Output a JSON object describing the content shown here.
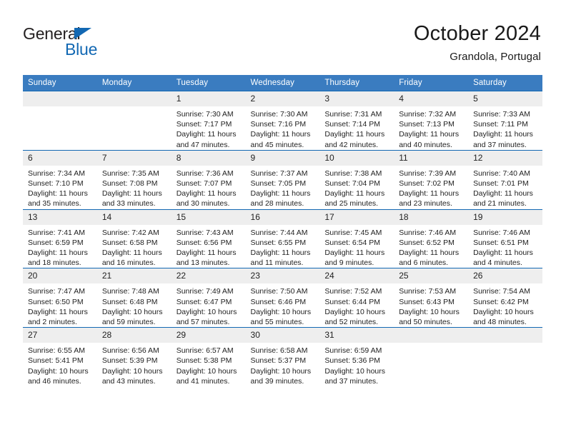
{
  "logo": {
    "word_general": "General",
    "word_blue": "Blue",
    "triangle_color": "#1268b3"
  },
  "header": {
    "title": "October 2024",
    "subtitle": "Grandola, Portugal",
    "accent_color": "#3a7cc0",
    "row_border_color": "#1268b3",
    "daynum_band_color": "#eeeeee"
  },
  "weekday_headers": [
    "Sunday",
    "Monday",
    "Tuesday",
    "Wednesday",
    "Thursday",
    "Friday",
    "Saturday"
  ],
  "labels": {
    "sunrise_prefix": "Sunrise:",
    "sunset_prefix": "Sunset:",
    "daylight_prefix": "Daylight:"
  },
  "weeks": [
    [
      {
        "day": "",
        "empty": true
      },
      {
        "day": "",
        "empty": true
      },
      {
        "day": "1",
        "sunrise": "Sunrise: 7:30 AM",
        "sunset": "Sunset: 7:17 PM",
        "daylight_l1": "Daylight: 11 hours",
        "daylight_l2": "and 47 minutes."
      },
      {
        "day": "2",
        "sunrise": "Sunrise: 7:30 AM",
        "sunset": "Sunset: 7:16 PM",
        "daylight_l1": "Daylight: 11 hours",
        "daylight_l2": "and 45 minutes."
      },
      {
        "day": "3",
        "sunrise": "Sunrise: 7:31 AM",
        "sunset": "Sunset: 7:14 PM",
        "daylight_l1": "Daylight: 11 hours",
        "daylight_l2": "and 42 minutes."
      },
      {
        "day": "4",
        "sunrise": "Sunrise: 7:32 AM",
        "sunset": "Sunset: 7:13 PM",
        "daylight_l1": "Daylight: 11 hours",
        "daylight_l2": "and 40 minutes."
      },
      {
        "day": "5",
        "sunrise": "Sunrise: 7:33 AM",
        "sunset": "Sunset: 7:11 PM",
        "daylight_l1": "Daylight: 11 hours",
        "daylight_l2": "and 37 minutes."
      }
    ],
    [
      {
        "day": "6",
        "sunrise": "Sunrise: 7:34 AM",
        "sunset": "Sunset: 7:10 PM",
        "daylight_l1": "Daylight: 11 hours",
        "daylight_l2": "and 35 minutes."
      },
      {
        "day": "7",
        "sunrise": "Sunrise: 7:35 AM",
        "sunset": "Sunset: 7:08 PM",
        "daylight_l1": "Daylight: 11 hours",
        "daylight_l2": "and 33 minutes."
      },
      {
        "day": "8",
        "sunrise": "Sunrise: 7:36 AM",
        "sunset": "Sunset: 7:07 PM",
        "daylight_l1": "Daylight: 11 hours",
        "daylight_l2": "and 30 minutes."
      },
      {
        "day": "9",
        "sunrise": "Sunrise: 7:37 AM",
        "sunset": "Sunset: 7:05 PM",
        "daylight_l1": "Daylight: 11 hours",
        "daylight_l2": "and 28 minutes."
      },
      {
        "day": "10",
        "sunrise": "Sunrise: 7:38 AM",
        "sunset": "Sunset: 7:04 PM",
        "daylight_l1": "Daylight: 11 hours",
        "daylight_l2": "and 25 minutes."
      },
      {
        "day": "11",
        "sunrise": "Sunrise: 7:39 AM",
        "sunset": "Sunset: 7:02 PM",
        "daylight_l1": "Daylight: 11 hours",
        "daylight_l2": "and 23 minutes."
      },
      {
        "day": "12",
        "sunrise": "Sunrise: 7:40 AM",
        "sunset": "Sunset: 7:01 PM",
        "daylight_l1": "Daylight: 11 hours",
        "daylight_l2": "and 21 minutes."
      }
    ],
    [
      {
        "day": "13",
        "sunrise": "Sunrise: 7:41 AM",
        "sunset": "Sunset: 6:59 PM",
        "daylight_l1": "Daylight: 11 hours",
        "daylight_l2": "and 18 minutes."
      },
      {
        "day": "14",
        "sunrise": "Sunrise: 7:42 AM",
        "sunset": "Sunset: 6:58 PM",
        "daylight_l1": "Daylight: 11 hours",
        "daylight_l2": "and 16 minutes."
      },
      {
        "day": "15",
        "sunrise": "Sunrise: 7:43 AM",
        "sunset": "Sunset: 6:56 PM",
        "daylight_l1": "Daylight: 11 hours",
        "daylight_l2": "and 13 minutes."
      },
      {
        "day": "16",
        "sunrise": "Sunrise: 7:44 AM",
        "sunset": "Sunset: 6:55 PM",
        "daylight_l1": "Daylight: 11 hours",
        "daylight_l2": "and 11 minutes."
      },
      {
        "day": "17",
        "sunrise": "Sunrise: 7:45 AM",
        "sunset": "Sunset: 6:54 PM",
        "daylight_l1": "Daylight: 11 hours",
        "daylight_l2": "and 9 minutes."
      },
      {
        "day": "18",
        "sunrise": "Sunrise: 7:46 AM",
        "sunset": "Sunset: 6:52 PM",
        "daylight_l1": "Daylight: 11 hours",
        "daylight_l2": "and 6 minutes."
      },
      {
        "day": "19",
        "sunrise": "Sunrise: 7:46 AM",
        "sunset": "Sunset: 6:51 PM",
        "daylight_l1": "Daylight: 11 hours",
        "daylight_l2": "and 4 minutes."
      }
    ],
    [
      {
        "day": "20",
        "sunrise": "Sunrise: 7:47 AM",
        "sunset": "Sunset: 6:50 PM",
        "daylight_l1": "Daylight: 11 hours",
        "daylight_l2": "and 2 minutes."
      },
      {
        "day": "21",
        "sunrise": "Sunrise: 7:48 AM",
        "sunset": "Sunset: 6:48 PM",
        "daylight_l1": "Daylight: 10 hours",
        "daylight_l2": "and 59 minutes."
      },
      {
        "day": "22",
        "sunrise": "Sunrise: 7:49 AM",
        "sunset": "Sunset: 6:47 PM",
        "daylight_l1": "Daylight: 10 hours",
        "daylight_l2": "and 57 minutes."
      },
      {
        "day": "23",
        "sunrise": "Sunrise: 7:50 AM",
        "sunset": "Sunset: 6:46 PM",
        "daylight_l1": "Daylight: 10 hours",
        "daylight_l2": "and 55 minutes."
      },
      {
        "day": "24",
        "sunrise": "Sunrise: 7:52 AM",
        "sunset": "Sunset: 6:44 PM",
        "daylight_l1": "Daylight: 10 hours",
        "daylight_l2": "and 52 minutes."
      },
      {
        "day": "25",
        "sunrise": "Sunrise: 7:53 AM",
        "sunset": "Sunset: 6:43 PM",
        "daylight_l1": "Daylight: 10 hours",
        "daylight_l2": "and 50 minutes."
      },
      {
        "day": "26",
        "sunrise": "Sunrise: 7:54 AM",
        "sunset": "Sunset: 6:42 PM",
        "daylight_l1": "Daylight: 10 hours",
        "daylight_l2": "and 48 minutes."
      }
    ],
    [
      {
        "day": "27",
        "sunrise": "Sunrise: 6:55 AM",
        "sunset": "Sunset: 5:41 PM",
        "daylight_l1": "Daylight: 10 hours",
        "daylight_l2": "and 46 minutes."
      },
      {
        "day": "28",
        "sunrise": "Sunrise: 6:56 AM",
        "sunset": "Sunset: 5:39 PM",
        "daylight_l1": "Daylight: 10 hours",
        "daylight_l2": "and 43 minutes."
      },
      {
        "day": "29",
        "sunrise": "Sunrise: 6:57 AM",
        "sunset": "Sunset: 5:38 PM",
        "daylight_l1": "Daylight: 10 hours",
        "daylight_l2": "and 41 minutes."
      },
      {
        "day": "30",
        "sunrise": "Sunrise: 6:58 AM",
        "sunset": "Sunset: 5:37 PM",
        "daylight_l1": "Daylight: 10 hours",
        "daylight_l2": "and 39 minutes."
      },
      {
        "day": "31",
        "sunrise": "Sunrise: 6:59 AM",
        "sunset": "Sunset: 5:36 PM",
        "daylight_l1": "Daylight: 10 hours",
        "daylight_l2": "and 37 minutes."
      },
      {
        "day": "",
        "empty": true
      },
      {
        "day": "",
        "empty": true
      }
    ]
  ]
}
